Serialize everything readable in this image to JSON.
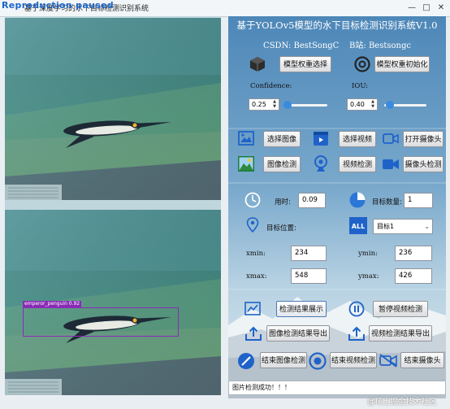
{
  "window": {
    "title": "基于深度学习的水下目标检测识别系统",
    "overlay_title": "Reproduction paused",
    "min": "—",
    "max": "□",
    "close": "✕"
  },
  "left": {
    "bottom_detection_label": "emperor_penguin 0.92"
  },
  "panel": {
    "header": "基于YOLOv5模型的水下目标检测识别系统V1.0",
    "csdn_label": "CSDN:",
    "csdn_value": "BestSongC",
    "bz_label": "B站:",
    "bz_value": "Bestsongc",
    "choose_weights": "模型权重选择",
    "init_weights": "模型权重初始化",
    "confidence_label": "Confidence:",
    "confidence_value": "0.25",
    "iou_label": "IOU:",
    "iou_value": "0.40",
    "select_image": "选择图像",
    "select_video": "选择视频",
    "open_camera": "打开摄像头",
    "image_detect": "图像检测",
    "video_detect": "视频检测",
    "camera_detect": "摄像头检测",
    "time_label": "用时:",
    "time_value": "0.09",
    "count_label": "目标数量:",
    "count_value": "1",
    "position_label": "目标位置:",
    "target_select": "目标1",
    "xmin_label": "xmin:",
    "xmin_value": "234",
    "ymin_label": "ymin:",
    "ymin_value": "236",
    "xmax_label": "xmax:",
    "xmax_value": "548",
    "ymax_label": "ymax:",
    "ymax_value": "426",
    "show_results": "检测结果展示",
    "pause_video": "暂停视频检测",
    "export_image": "图像检测结果导出",
    "export_video": "视频检测结果导出",
    "end_image": "结束图像检测",
    "end_video": "结束视频检测",
    "end_camera": "结束摄像头",
    "status": "图片检测成功！！！"
  },
  "watermark": "@稀土掘金技术社区",
  "colors": {
    "accent_blue": "#3a8be0",
    "box_purple": "#8a2bb6",
    "header_text": "#ffffff"
  },
  "icons": [
    "cube-icon",
    "gear-icon",
    "image-icon",
    "video-play-icon",
    "camera-icon",
    "landscape-icon",
    "webcam-icon",
    "video-camera-icon",
    "clock-icon",
    "pie-chart-icon",
    "location-pin-icon",
    "all-icon",
    "line-chart-icon",
    "pause-icon",
    "upload-icon",
    "stop-icon",
    "camera-off-icon"
  ]
}
